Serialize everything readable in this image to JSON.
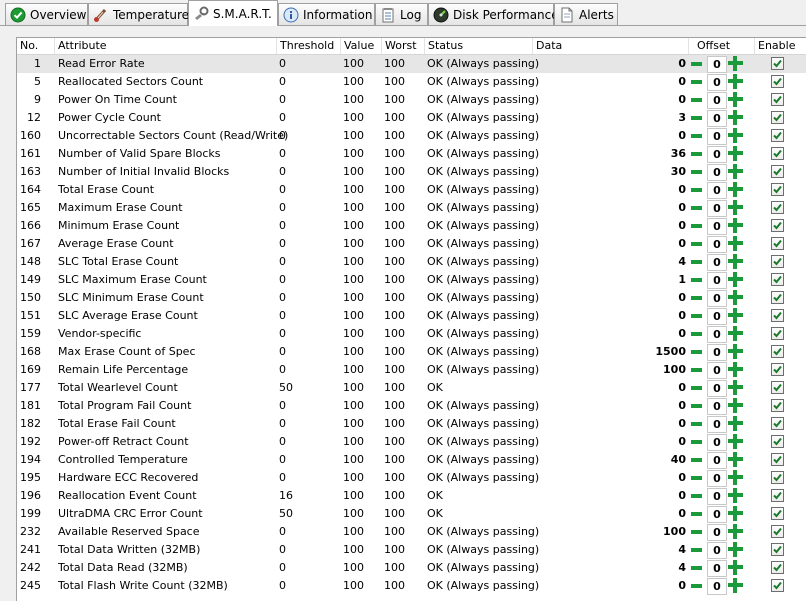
{
  "tabs": [
    {
      "label": "Overview",
      "icon": "green-check-icon"
    },
    {
      "label": "Temperature",
      "icon": "thermometer-icon"
    },
    {
      "label": "S.M.A.R.T.",
      "icon": "smart-wrench-icon",
      "active": true
    },
    {
      "label": "Information",
      "icon": "info-icon"
    },
    {
      "label": "Log",
      "icon": "notepad-icon"
    },
    {
      "label": "Disk Performance",
      "icon": "gauge-icon"
    },
    {
      "label": "Alerts",
      "icon": "document-icon"
    }
  ],
  "columns": {
    "no": "No.",
    "attribute": "Attribute",
    "threshold": "Threshold",
    "value": "Value",
    "worst": "Worst",
    "status": "Status",
    "data": "Data",
    "offset": "Offset",
    "enable": "Enable"
  },
  "rows": [
    {
      "no": "1",
      "attribute": "Read Error Rate",
      "threshold": "0",
      "value": "100",
      "worst": "100",
      "status": "OK (Always passing)",
      "data": "0",
      "offset": "0",
      "enabled": true
    },
    {
      "no": "5",
      "attribute": "Reallocated Sectors Count",
      "threshold": "0",
      "value": "100",
      "worst": "100",
      "status": "OK (Always passing)",
      "data": "0",
      "offset": "0",
      "enabled": true
    },
    {
      "no": "9",
      "attribute": "Power On Time Count",
      "threshold": "0",
      "value": "100",
      "worst": "100",
      "status": "OK (Always passing)",
      "data": "0",
      "offset": "0",
      "enabled": true
    },
    {
      "no": "12",
      "attribute": "Power Cycle Count",
      "threshold": "0",
      "value": "100",
      "worst": "100",
      "status": "OK (Always passing)",
      "data": "3",
      "offset": "0",
      "enabled": true
    },
    {
      "no": "160",
      "attribute": "Uncorrectable Sectors Count (Read/Write)",
      "threshold": "0",
      "value": "100",
      "worst": "100",
      "status": "OK (Always passing)",
      "data": "0",
      "offset": "0",
      "enabled": true
    },
    {
      "no": "161",
      "attribute": "Number of Valid Spare Blocks",
      "threshold": "0",
      "value": "100",
      "worst": "100",
      "status": "OK (Always passing)",
      "data": "36",
      "offset": "0",
      "enabled": true
    },
    {
      "no": "163",
      "attribute": "Number of Initial Invalid Blocks",
      "threshold": "0",
      "value": "100",
      "worst": "100",
      "status": "OK (Always passing)",
      "data": "30",
      "offset": "0",
      "enabled": true
    },
    {
      "no": "164",
      "attribute": "Total Erase Count",
      "threshold": "0",
      "value": "100",
      "worst": "100",
      "status": "OK (Always passing)",
      "data": "0",
      "offset": "0",
      "enabled": true
    },
    {
      "no": "165",
      "attribute": "Maximum Erase Count",
      "threshold": "0",
      "value": "100",
      "worst": "100",
      "status": "OK (Always passing)",
      "data": "0",
      "offset": "0",
      "enabled": true
    },
    {
      "no": "166",
      "attribute": "Minimum Erase Count",
      "threshold": "0",
      "value": "100",
      "worst": "100",
      "status": "OK (Always passing)",
      "data": "0",
      "offset": "0",
      "enabled": true
    },
    {
      "no": "167",
      "attribute": "Average Erase Count",
      "threshold": "0",
      "value": "100",
      "worst": "100",
      "status": "OK (Always passing)",
      "data": "0",
      "offset": "0",
      "enabled": true
    },
    {
      "no": "148",
      "attribute": "SLC Total Erase Count",
      "threshold": "0",
      "value": "100",
      "worst": "100",
      "status": "OK (Always passing)",
      "data": "4",
      "offset": "0",
      "enabled": true
    },
    {
      "no": "149",
      "attribute": "SLC Maximum Erase Count",
      "threshold": "0",
      "value": "100",
      "worst": "100",
      "status": "OK (Always passing)",
      "data": "1",
      "offset": "0",
      "enabled": true
    },
    {
      "no": "150",
      "attribute": "SLC Minimum Erase Count",
      "threshold": "0",
      "value": "100",
      "worst": "100",
      "status": "OK (Always passing)",
      "data": "0",
      "offset": "0",
      "enabled": true
    },
    {
      "no": "151",
      "attribute": "SLC Average Erase Count",
      "threshold": "0",
      "value": "100",
      "worst": "100",
      "status": "OK (Always passing)",
      "data": "0",
      "offset": "0",
      "enabled": true
    },
    {
      "no": "159",
      "attribute": "Vendor-specific",
      "threshold": "0",
      "value": "100",
      "worst": "100",
      "status": "OK (Always passing)",
      "data": "0",
      "offset": "0",
      "enabled": true
    },
    {
      "no": "168",
      "attribute": "Max Erase Count of Spec",
      "threshold": "0",
      "value": "100",
      "worst": "100",
      "status": "OK (Always passing)",
      "data": "1500",
      "offset": "0",
      "enabled": true
    },
    {
      "no": "169",
      "attribute": "Remain Life Percentage",
      "threshold": "0",
      "value": "100",
      "worst": "100",
      "status": "OK (Always passing)",
      "data": "100",
      "offset": "0",
      "enabled": true
    },
    {
      "no": "177",
      "attribute": "Total Wearlevel Count",
      "threshold": "50",
      "value": "100",
      "worst": "100",
      "status": "OK",
      "data": "0",
      "offset": "0",
      "enabled": true
    },
    {
      "no": "181",
      "attribute": "Total Program Fail Count",
      "threshold": "0",
      "value": "100",
      "worst": "100",
      "status": "OK (Always passing)",
      "data": "0",
      "offset": "0",
      "enabled": true
    },
    {
      "no": "182",
      "attribute": "Total Erase Fail Count",
      "threshold": "0",
      "value": "100",
      "worst": "100",
      "status": "OK (Always passing)",
      "data": "0",
      "offset": "0",
      "enabled": true
    },
    {
      "no": "192",
      "attribute": "Power-off Retract Count",
      "threshold": "0",
      "value": "100",
      "worst": "100",
      "status": "OK (Always passing)",
      "data": "0",
      "offset": "0",
      "enabled": true
    },
    {
      "no": "194",
      "attribute": "Controlled Temperature",
      "threshold": "0",
      "value": "100",
      "worst": "100",
      "status": "OK (Always passing)",
      "data": "40",
      "offset": "0",
      "enabled": true
    },
    {
      "no": "195",
      "attribute": "Hardware ECC Recovered",
      "threshold": "0",
      "value": "100",
      "worst": "100",
      "status": "OK (Always passing)",
      "data": "0",
      "offset": "0",
      "enabled": true
    },
    {
      "no": "196",
      "attribute": "Reallocation Event Count",
      "threshold": "16",
      "value": "100",
      "worst": "100",
      "status": "OK",
      "data": "0",
      "offset": "0",
      "enabled": true
    },
    {
      "no": "199",
      "attribute": "UltraDMA CRC Error Count",
      "threshold": "50",
      "value": "100",
      "worst": "100",
      "status": "OK",
      "data": "0",
      "offset": "0",
      "enabled": true
    },
    {
      "no": "232",
      "attribute": "Available Reserved Space",
      "threshold": "0",
      "value": "100",
      "worst": "100",
      "status": "OK (Always passing)",
      "data": "100",
      "offset": "0",
      "enabled": true
    },
    {
      "no": "241",
      "attribute": "Total Data Written (32MB)",
      "threshold": "0",
      "value": "100",
      "worst": "100",
      "status": "OK (Always passing)",
      "data": "4",
      "offset": "0",
      "enabled": true
    },
    {
      "no": "242",
      "attribute": "Total Data Read (32MB)",
      "threshold": "0",
      "value": "100",
      "worst": "100",
      "status": "OK (Always passing)",
      "data": "4",
      "offset": "0",
      "enabled": true
    },
    {
      "no": "245",
      "attribute": "Total Flash Write Count (32MB)",
      "threshold": "0",
      "value": "100",
      "worst": "100",
      "status": "OK (Always passing)",
      "data": "0",
      "offset": "0",
      "enabled": true
    }
  ],
  "colors": {
    "accent_green": "#1a9a3a",
    "selected_row": "#e6e6e6",
    "tab_border": "#a0a0a0"
  }
}
